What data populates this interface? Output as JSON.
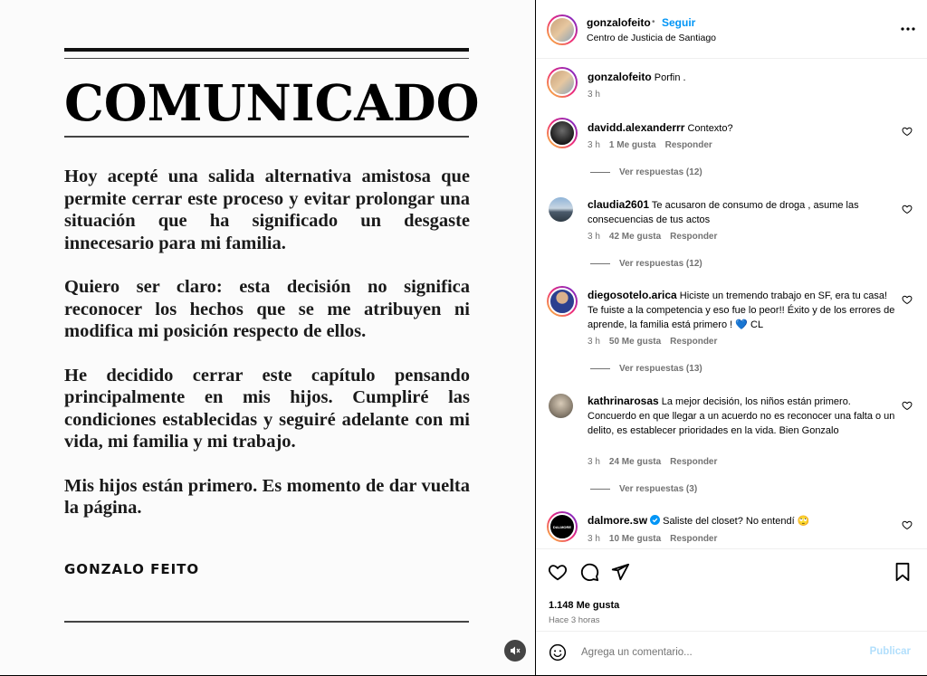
{
  "post": {
    "headline": "COMUNICADO",
    "paragraphs": [
      "Hoy acepté una salida alternativa amistosa que permite cerrar este proceso y evitar prolongar una situación que ha significado un desgaste innecesario para mi familia.",
      "Quiero ser claro: esta decisión no significa reconocer los hechos que se me atribuyen ni modifica mi posición respecto de ellos.",
      "He decidido cerrar este capítulo pensando principalmente en mis hijos. Cumpliré las condiciones establecidas y seguiré adelante con mi vida, mi familia y mi trabajo.",
      "Mis hijos están primero. Es momento de dar vuelta la página."
    ],
    "signature": "GONZALO FEITO"
  },
  "header": {
    "username": "gonzalofeito",
    "dot": "•",
    "follow_label": "Seguir",
    "location": "Centro de Justicia de Santiago",
    "more_icon": "more-horizontal-icon"
  },
  "caption": {
    "username": "gonzalofeito",
    "text": "Porfin .",
    "time": "3 h"
  },
  "comments": [
    {
      "username": "davidd.alexanderrr",
      "text": "Contexto?",
      "time": "3 h",
      "likes": "1 Me gusta",
      "reply": "Responder",
      "view_replies": "Ver respuestas (12)"
    },
    {
      "username": "claudia2601",
      "text": "Te acusaron de consumo de droga , asume las consecuencias de tus actos",
      "time": "3 h",
      "likes": "42 Me gusta",
      "reply": "Responder",
      "view_replies": "Ver respuestas (12)"
    },
    {
      "username": "diegosotelo.arica",
      "text": "Hiciste un tremendo trabajo en SF, era tu casa! Te fuiste a la competencia y eso fue lo peor!! Éxito y de los errores de aprende, la familia está primero ! 💙 CL",
      "time": "3 h",
      "likes": "50 Me gusta",
      "reply": "Responder",
      "view_replies": "Ver respuestas (13)"
    },
    {
      "username": "kathrinarosas",
      "text": "La mejor decisión, los niños están primero. Concuerdo en que llegar a un acuerdo no es reconocer una falta o un delito, es establecer prioridades en la vida. Bien Gonzalo",
      "time": "3 h",
      "likes": "24 Me gusta",
      "reply": "Responder",
      "view_replies": "Ver respuestas (3)"
    },
    {
      "username": "dalmore.sw",
      "text": "Saliste del closet? No entendí 🙄",
      "time": "3 h",
      "likes": "10 Me gusta",
      "reply": "Responder",
      "avatar_text": "DALMORE"
    }
  ],
  "actions": {
    "likes": "1.148 Me gusta",
    "time": "Hace 3 horas"
  },
  "comment_box": {
    "placeholder": "Agrega un comentario...",
    "publish_label": "Publicar"
  },
  "colors": {
    "accent": "#0095f6",
    "muted": "#737373",
    "verified": "#0095f6"
  }
}
